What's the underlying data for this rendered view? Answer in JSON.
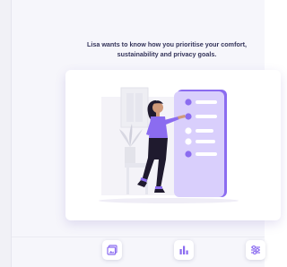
{
  "prompt": {
    "line1": "Lisa wants to know how you prioritise your comfort,",
    "line2": "sustainability and privacy goals."
  },
  "colors": {
    "accent": "#8b6cf0",
    "accent_light": "#d9cffc",
    "text": "#34345a"
  },
  "bottom_toolbar": {
    "buttons": [
      {
        "icon": "gallery-icon"
      },
      {
        "icon": "bar-chart-icon"
      },
      {
        "icon": "sliders-icon"
      }
    ]
  }
}
